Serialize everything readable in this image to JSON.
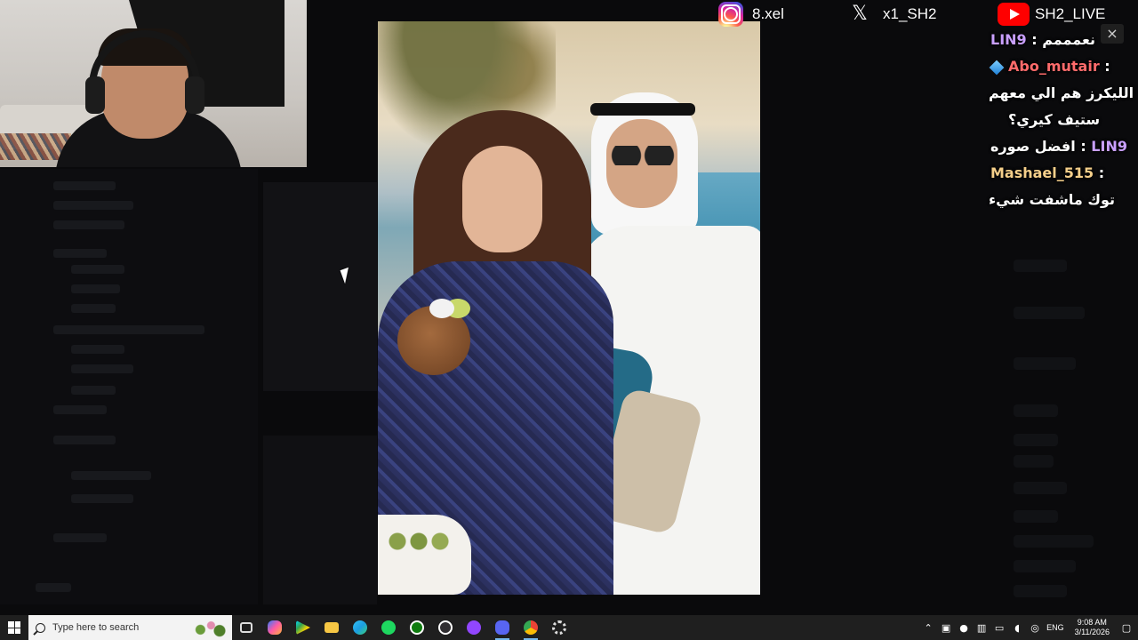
{
  "overlay": {
    "instagram": {
      "icon": "instagram-icon",
      "handle": "8.xel"
    },
    "x": {
      "icon": "x-logo-icon",
      "handle": "x1_SH2"
    },
    "youtube": {
      "icon": "youtube-icon",
      "handle": "SH2_LIVE"
    }
  },
  "chat": {
    "messages": [
      {
        "user": "LIN9",
        "text": "نعمممم"
      },
      {
        "user": "Abo_mutair",
        "badge": "cube-icon",
        "text_line1": "الليكرز هم الي معهم",
        "text_line2": "ستيف كيري؟"
      },
      {
        "user": "LIN9",
        "text": "افضل صوره"
      },
      {
        "user": "Mashael_515",
        "text": "توك ماشفت شيء"
      }
    ],
    "separator": ":",
    "close_symbol": "×"
  },
  "taskbar": {
    "search_placeholder": "Type here to search",
    "apps": [
      "task-view-icon",
      "copilot-icon",
      "play-store-icon",
      "file-explorer-icon",
      "edge-icon",
      "spotify-icon",
      "xbox-icon",
      "obs-icon",
      "twitch-icon",
      "discord-icon",
      "chrome-icon",
      "settings-icon"
    ],
    "language": "ENG",
    "time": "9:08 AM",
    "date": "3/11/2026"
  },
  "colors": {
    "taskbar_bg": "#1f1f1f",
    "chat_name_purple": "#c9a0ff",
    "chat_name_red": "#ff6b6b",
    "chat_name_gold": "#f5cf8a",
    "youtube_red": "#ff0000"
  }
}
